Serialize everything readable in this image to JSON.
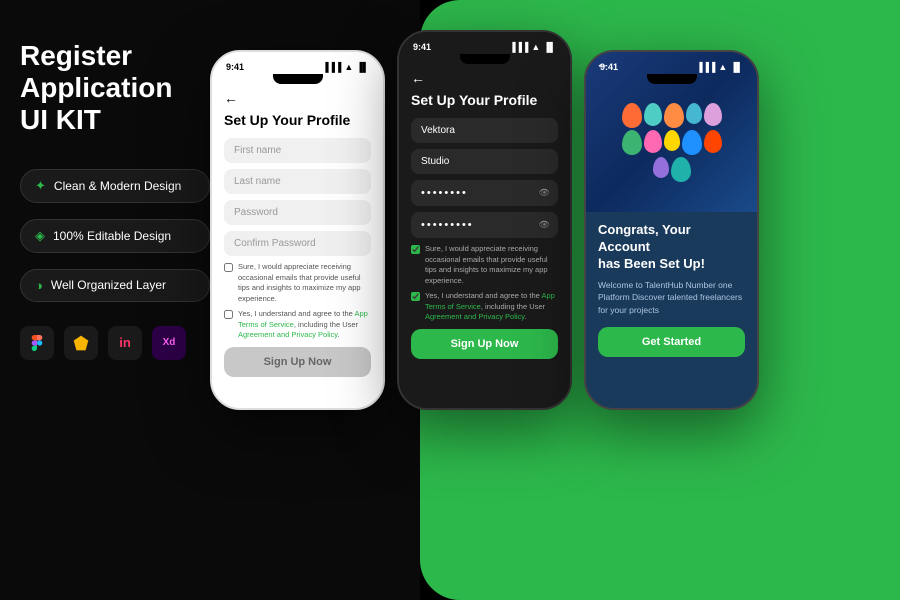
{
  "app": {
    "title": "Register\nApplication\nUI KIT"
  },
  "features": [
    {
      "id": "clean-design",
      "icon": "✦",
      "label": "Clean & Modern Design"
    },
    {
      "id": "editable",
      "icon": "◈",
      "label": "100% Editable Design"
    },
    {
      "id": "organized",
      "icon": "◑",
      "label": "Well Organized Layer"
    }
  ],
  "tools": [
    {
      "id": "figma",
      "label": "F",
      "color": "figma"
    },
    {
      "id": "sketch",
      "label": "S",
      "color": "sketch"
    },
    {
      "id": "invision",
      "label": "i",
      "color": "invision"
    },
    {
      "id": "xd",
      "label": "Xd",
      "color": "xd"
    }
  ],
  "phone1": {
    "time": "9:41",
    "back": "←",
    "title": "Set Up Your Profile",
    "fields": [
      {
        "id": "first-name",
        "placeholder": "First name",
        "value": ""
      },
      {
        "id": "last-name",
        "placeholder": "Last name",
        "value": ""
      },
      {
        "id": "password",
        "placeholder": "Password",
        "value": ""
      },
      {
        "id": "confirm-password",
        "placeholder": "Confirm Password",
        "value": ""
      }
    ],
    "checkboxes": [
      {
        "id": "emails",
        "text": "Sure, I would appreciate receiving occasional emails that provide useful tips and insights to maximize my app experience.",
        "checked": false
      },
      {
        "id": "terms",
        "text": "Yes, I understand and agree to the ",
        "link": "App Terms of Service",
        "text2": ", including the User ",
        "link2": "Agreement and Privacy Policy",
        "checked": false
      }
    ],
    "cta": "Sign Up Now"
  },
  "phone2": {
    "time": "9:41",
    "back": "←",
    "title": "Set Up Your Profile",
    "fields": [
      {
        "id": "first-name",
        "placeholder": "",
        "value": "Vektora",
        "filled": true
      },
      {
        "id": "last-name",
        "placeholder": "",
        "value": "Studio",
        "filled": true
      },
      {
        "id": "password",
        "placeholder": "",
        "value": "••••••••",
        "type": "password"
      },
      {
        "id": "confirm-password",
        "placeholder": "",
        "value": "•••••••••",
        "type": "password"
      }
    ],
    "checkboxes": [
      {
        "id": "emails",
        "text": "Sure, I would appreciate receiving occasional emails that provide useful tips and insights to maximize my app experience.",
        "checked": true
      },
      {
        "id": "terms",
        "text": "Yes, I understand and agree to the ",
        "link": "App Terms of Service",
        "text2": ", including the User ",
        "link2": "Agreement and Privacy Policy",
        "checked": true
      }
    ],
    "cta": "Sign Up Now"
  },
  "phone3": {
    "time": "9:41",
    "back": "←",
    "congrats": "Congrats, Your Account\nhas Been Set Up!",
    "welcome": "Welcome to TalentHub Number one Platform Discover talented freelancers for your projects",
    "cta": "Get Started"
  },
  "balloons": [
    "#FF6B35",
    "#FF8C42",
    "#4ECDC4",
    "#45B7D1",
    "#96CEB4",
    "#FFEAA7",
    "#DDA0DD",
    "#FF69B4",
    "#FFA07A",
    "#98FB98",
    "#87CEEB",
    "#F0E68C",
    "#20B2AA",
    "#FF7F50",
    "#9370DB",
    "#3CB371",
    "#FF4500",
    "#1E90FF",
    "#FFD700",
    "#DC143C"
  ]
}
